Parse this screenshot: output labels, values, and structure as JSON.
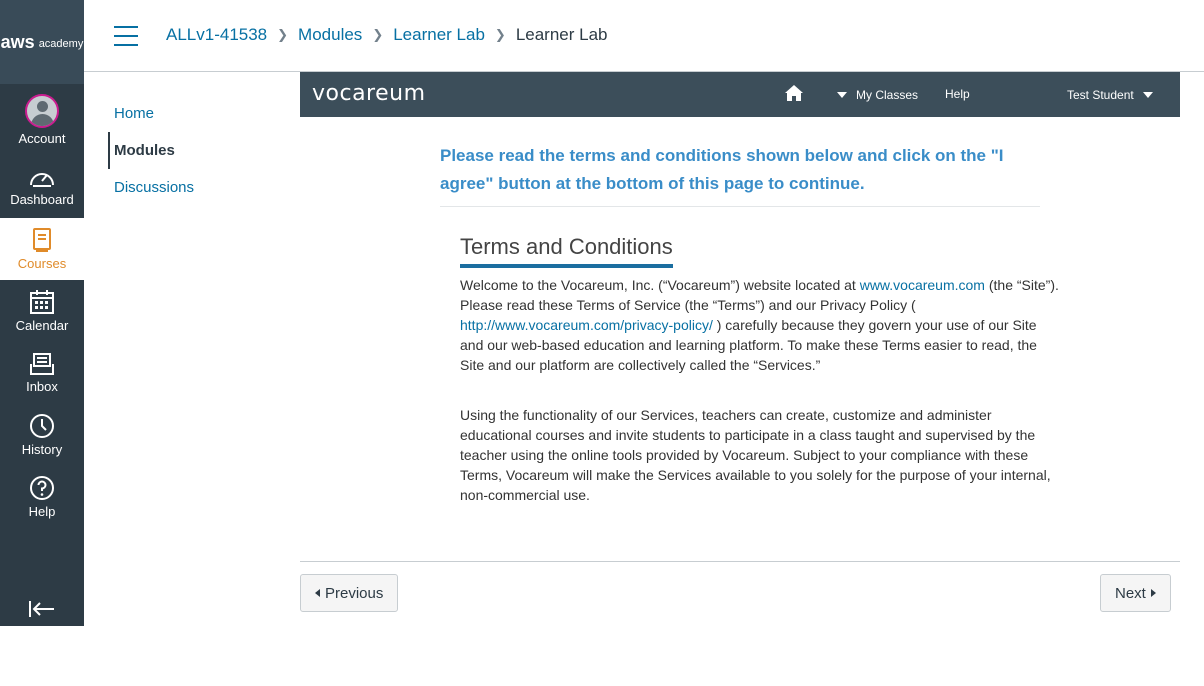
{
  "global_nav": {
    "logo_text": "aws",
    "logo_sub": "academy",
    "items": [
      {
        "label": "Account",
        "icon": "user-avatar-icon"
      },
      {
        "label": "Dashboard",
        "icon": "dashboard-gauge-icon"
      },
      {
        "label": "Courses",
        "icon": "book-icon"
      },
      {
        "label": "Calendar",
        "icon": "calendar-icon"
      },
      {
        "label": "Inbox",
        "icon": "inbox-icon"
      },
      {
        "label": "History",
        "icon": "clock-icon"
      },
      {
        "label": "Help",
        "icon": "question-circle-icon"
      }
    ],
    "active_item": "Courses",
    "collapse_icon": "collapse-arrow-icon"
  },
  "breadcrumb": [
    "ALLv1-41538",
    "Modules",
    "Learner Lab",
    "Learner Lab"
  ],
  "course_nav": {
    "items": [
      "Home",
      "Modules",
      "Discussions"
    ],
    "active_item": "Modules"
  },
  "vocareum": {
    "logo": "vocareum",
    "home_icon": "home-icon",
    "my_classes": "My Classes",
    "help": "Help",
    "user": "Test Student",
    "notice": "Please read the terms and conditions shown below and click on the \"I agree\" button at the bottom of this page to continue.",
    "terms_title": "Terms and Conditions",
    "para1": {
      "t1": "Welcome to the Vocareum, Inc. (“Vocareum”) website located at ",
      "link1": "www.vocareum.com",
      "t2": " (the “Site”). Please read these Terms of Service (the “Terms”) and our Privacy Policy ( ",
      "link2": "http://www.vocareum.com/privacy-policy/",
      "t3": " ) carefully because they govern your use of our Site and our web-based education and learning platform. To make these Terms easier to read, the Site and our platform are collectively called the “Services.”"
    },
    "para2": "Using the functionality of our Services, teachers can create, customize and administer educational courses and invite students to participate in a class taught and supervised by the teacher using the online tools provided by Vocareum. Subject to your compliance with these Terms, Vocareum will make the Services available to you solely for the purpose of your internal, non-commercial use."
  },
  "footer": {
    "previous": "Previous",
    "next": "Next"
  },
  "colors": {
    "nav_bg": "#2d3b45",
    "link": "#0770a3",
    "accent": "#e08b2a",
    "notice": "#3a8dc8"
  }
}
